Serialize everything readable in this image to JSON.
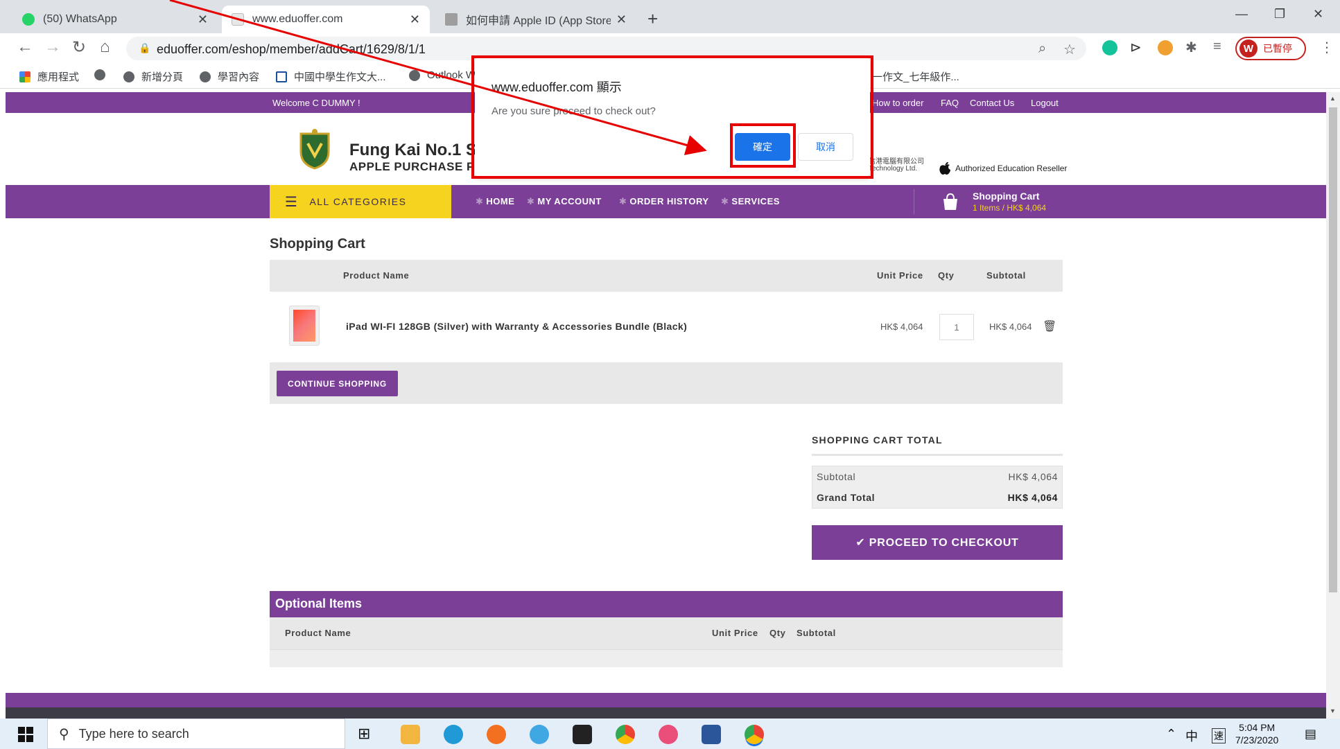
{
  "browser": {
    "tabs": [
      {
        "label": "(50) WhatsApp",
        "icon": "whatsapp-icon",
        "color": "#25d366"
      },
      {
        "label": "www.eduoffer.com",
        "icon": "page-icon",
        "color": "#bdbdbd"
      },
      {
        "label": "如何申請 Apple ID (App Store 帳",
        "icon": "doc-icon",
        "color": "#9e9e9e"
      }
    ],
    "url": "eduoffer.com/eshop/member/addCart/1629/8/1/1",
    "profile_label": "已暫停",
    "profile_initial": "W",
    "bookmarks": [
      "應用程式",
      "",
      "新增分頁",
      "學習內容",
      "中國中學生作文大...",
      "Outlook W",
      "一作文_七年級作..."
    ]
  },
  "site": {
    "welcome": "Welcome C DUMMY !",
    "top_links": [
      "How to order",
      "FAQ",
      "Contact Us",
      "Logout"
    ],
    "brand_name": "Fung Kai No.1 S",
    "brand_sub": "APPLE PURCHASE PR",
    "partner_name": "信港電腦有限公司",
    "partner_sub": "Technology Ltd.",
    "reseller": "Authorized Education Reseller",
    "all_categories": "ALL CATEGORIES",
    "nav": [
      "HOME",
      "MY ACCOUNT",
      "ORDER HISTORY",
      "SERVICES"
    ],
    "cart_widget_title": "Shopping Cart",
    "cart_widget_summary": "1 Items / HK$ 4,064"
  },
  "cart": {
    "title": "Shopping Cart",
    "columns": {
      "product": "Product Name",
      "unit_price": "Unit Price",
      "qty": "Qty",
      "subtotal": "Subtotal"
    },
    "items": [
      {
        "name": "iPad WI-FI 128GB (Silver) with Warranty & Accessories Bundle (Black)",
        "unit_price": "HK$ 4,064",
        "qty": "1",
        "subtotal": "HK$ 4,064"
      }
    ],
    "continue_label": "CONTINUE SHOPPING",
    "total_title": "SHOPPING CART TOTAL",
    "subtotal_label": "Subtotal",
    "subtotal_value": "HK$ 4,064",
    "grand_label": "Grand Total",
    "grand_value": "HK$ 4,064",
    "checkout_label": "✔ PROCEED TO CHECKOUT"
  },
  "optional": {
    "title": "Optional Items",
    "columns": {
      "product": "Product Name",
      "unit_price": "Unit Price",
      "qty": "Qty",
      "subtotal": "Subtotal"
    }
  },
  "dialog": {
    "title": "www.eduoffer.com 顯示",
    "message": "Are you sure proceed to check out?",
    "ok_label": "確定",
    "cancel_label": "取消"
  },
  "annotation_color": "#e60000",
  "taskbar": {
    "search_placeholder": "Type here to search",
    "tray_lang": "中",
    "tray_ime": "速",
    "time": "5:04 PM",
    "date": "7/23/2020"
  }
}
